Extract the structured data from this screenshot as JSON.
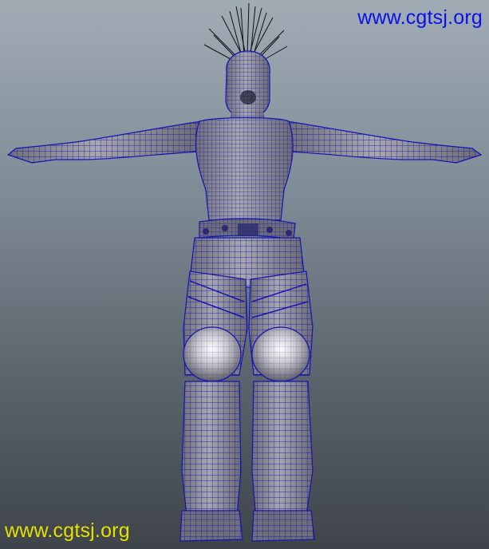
{
  "viewport": {
    "type": "3D wireframe-on-shaded character model",
    "background_gradient": [
      "#a1acb5",
      "#3f444a"
    ],
    "wire_color": "#1414b4",
    "shading_color": "#9a9a9a"
  },
  "watermarks": {
    "top_right": "www.cgtsj.org",
    "bottom_left": "www.cgtsj.org",
    "top_right_color": "#0a10e8",
    "bottom_left_color": "#e6e000"
  }
}
